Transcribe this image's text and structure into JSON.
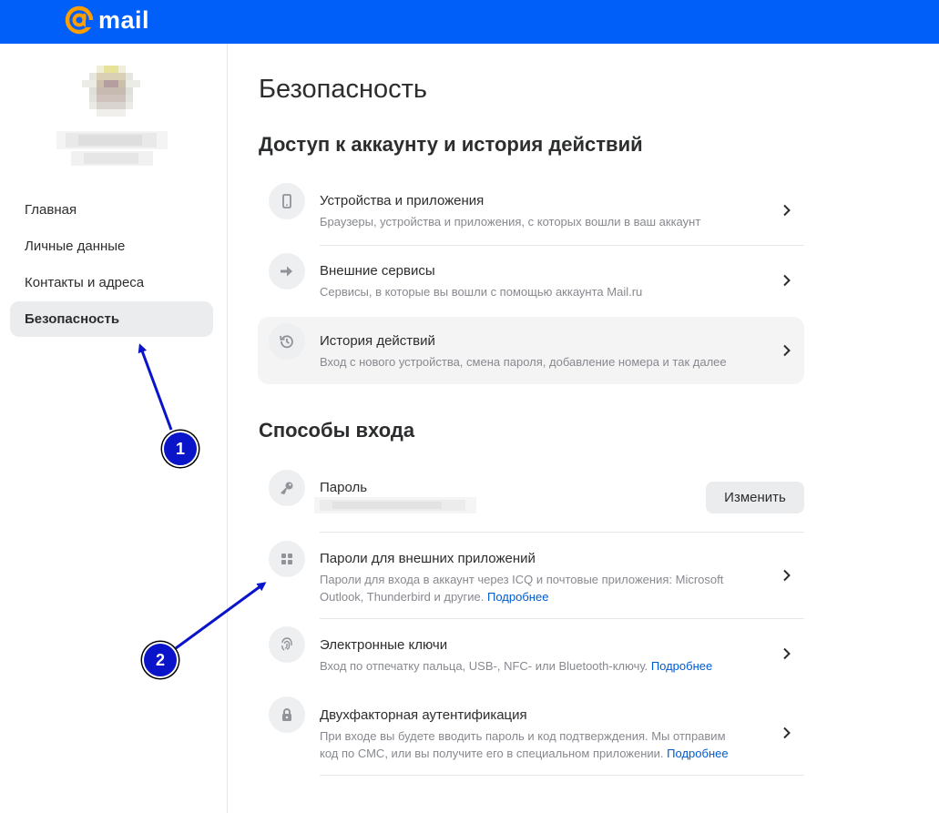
{
  "brand": {
    "name": "mail",
    "color": "#005ff9",
    "accent": "#ff9e00"
  },
  "sidebar": {
    "items": [
      {
        "label": "Главная",
        "active": false
      },
      {
        "label": "Личные данные",
        "active": false
      },
      {
        "label": "Контакты и адреса",
        "active": false
      },
      {
        "label": "Безопасность",
        "active": true
      }
    ]
  },
  "main": {
    "title": "Безопасность",
    "access_section": {
      "title": "Доступ к аккаунту и история действий",
      "items": [
        {
          "icon": "phone-icon",
          "title": "Устройства и приложения",
          "subtitle": "Браузеры, устройства и приложения, с которых вошли в ваш аккаунт"
        },
        {
          "icon": "arrow-right-icon",
          "title": "Внешние сервисы",
          "subtitle": "Сервисы, в которые вы вошли с помощью аккаунта Mail.ru"
        },
        {
          "icon": "history-icon",
          "title": "История действий",
          "subtitle": "Вход с нового устройства, смена пароля, добавление номера и так далее"
        }
      ]
    },
    "login_section": {
      "title": "Способы входа",
      "password": {
        "icon": "key-icon",
        "title": "Пароль",
        "button": "Изменить"
      },
      "items": [
        {
          "icon": "grid-icon",
          "title": "Пароли для внешних приложений",
          "subtitle": "Пароли для входа в аккаунт через ICQ и почтовые приложения: Microsoft Outlook, Thunderbird и другие.",
          "link": "Подробнее"
        },
        {
          "icon": "fingerprint-icon",
          "title": "Электронные ключи",
          "subtitle": "Вход по отпечатку пальца, USB-, NFC- или Bluetooth-ключу.",
          "link": "Подробнее"
        },
        {
          "icon": "lock-icon",
          "title": "Двухфакторная аутентификация",
          "subtitle": "При входе вы будете вводить пароль и код подтверждения. Мы отправим код по СМС, или вы получите его в специальном приложении.",
          "link": "Подробнее"
        }
      ]
    }
  },
  "annotations": {
    "marker_1": "1",
    "marker_2": "2",
    "color": "#0a14c9"
  }
}
